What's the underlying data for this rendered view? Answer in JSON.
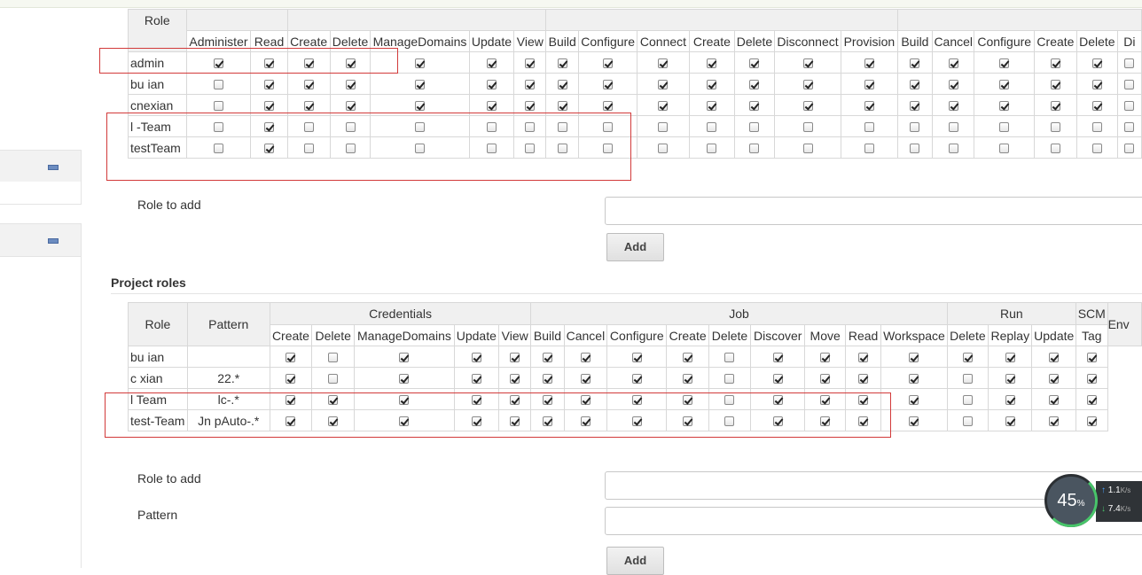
{
  "global_roles": {
    "role_header": "Role",
    "permissions": [
      "Administer",
      "Read",
      "Create",
      "Delete",
      "ManageDomains",
      "Update",
      "View",
      "Build",
      "Configure",
      "Connect",
      "Create",
      "Delete",
      "Disconnect",
      "Provision",
      "Build",
      "Cancel",
      "Configure",
      "Create",
      "Delete",
      "Di"
    ],
    "rows": [
      {
        "name": "admin",
        "checks": [
          1,
          1,
          1,
          1,
          1,
          1,
          1,
          1,
          1,
          1,
          1,
          1,
          1,
          1,
          1,
          1,
          1,
          1,
          1,
          0
        ]
      },
      {
        "name": "bu ian",
        "checks": [
          0,
          1,
          1,
          1,
          1,
          1,
          1,
          1,
          1,
          1,
          1,
          1,
          1,
          1,
          1,
          1,
          1,
          1,
          1,
          0
        ]
      },
      {
        "name": "cnexian",
        "checks": [
          0,
          1,
          1,
          1,
          1,
          1,
          1,
          1,
          1,
          1,
          1,
          1,
          1,
          1,
          1,
          1,
          1,
          1,
          1,
          0
        ]
      },
      {
        "name": "l  -Team",
        "checks": [
          0,
          1,
          0,
          0,
          0,
          0,
          0,
          0,
          0,
          0,
          0,
          0,
          0,
          0,
          0,
          0,
          0,
          0,
          0,
          0
        ]
      },
      {
        "name": "testTeam",
        "checks": [
          0,
          1,
          0,
          0,
          0,
          0,
          0,
          0,
          0,
          0,
          0,
          0,
          0,
          0,
          0,
          0,
          0,
          0,
          0,
          0
        ]
      }
    ],
    "role_to_add_label": "Role to add",
    "add_button": "Add"
  },
  "project_roles": {
    "title": "Project roles",
    "role_header": "Role",
    "pattern_header": "Pattern",
    "groups": [
      "Credentials",
      "Job",
      "Run",
      "SCM",
      "Env"
    ],
    "permissions": [
      "Create",
      "Delete",
      "ManageDomains",
      "Update",
      "View",
      "Build",
      "Cancel",
      "Configure",
      "Create",
      "Delete",
      "Discover",
      "Move",
      "Read",
      "Workspace",
      "Delete",
      "Replay",
      "Update",
      "Tag"
    ],
    "rows": [
      {
        "name": "bu  ian",
        "pattern": "",
        "checks": [
          1,
          0,
          1,
          1,
          1,
          1,
          1,
          1,
          1,
          0,
          1,
          1,
          1,
          1,
          1,
          1,
          1,
          1
        ]
      },
      {
        "name": "c  xian",
        "pattern": " 22.*",
        "checks": [
          1,
          0,
          1,
          1,
          1,
          1,
          1,
          1,
          1,
          0,
          1,
          1,
          1,
          1,
          0,
          1,
          1,
          1
        ]
      },
      {
        "name": "l  Team",
        "pattern": "lc-.*",
        "checks": [
          1,
          1,
          1,
          1,
          1,
          1,
          1,
          1,
          1,
          0,
          1,
          1,
          1,
          1,
          0,
          1,
          1,
          1
        ]
      },
      {
        "name": "test-Team",
        "pattern": "Jn  pAuto-.*",
        "checks": [
          1,
          1,
          1,
          1,
          1,
          1,
          1,
          1,
          1,
          0,
          1,
          1,
          1,
          1,
          0,
          1,
          1,
          1
        ]
      }
    ],
    "role_to_add_label": "Role to add",
    "pattern_label": "Pattern",
    "add_button": "Add"
  },
  "speed_widget": {
    "percent": "45",
    "percent_unit": "%",
    "up_rate": "1.1",
    "up_unit": "K/s",
    "down_rate": "7.4",
    "down_unit": "K/s"
  }
}
